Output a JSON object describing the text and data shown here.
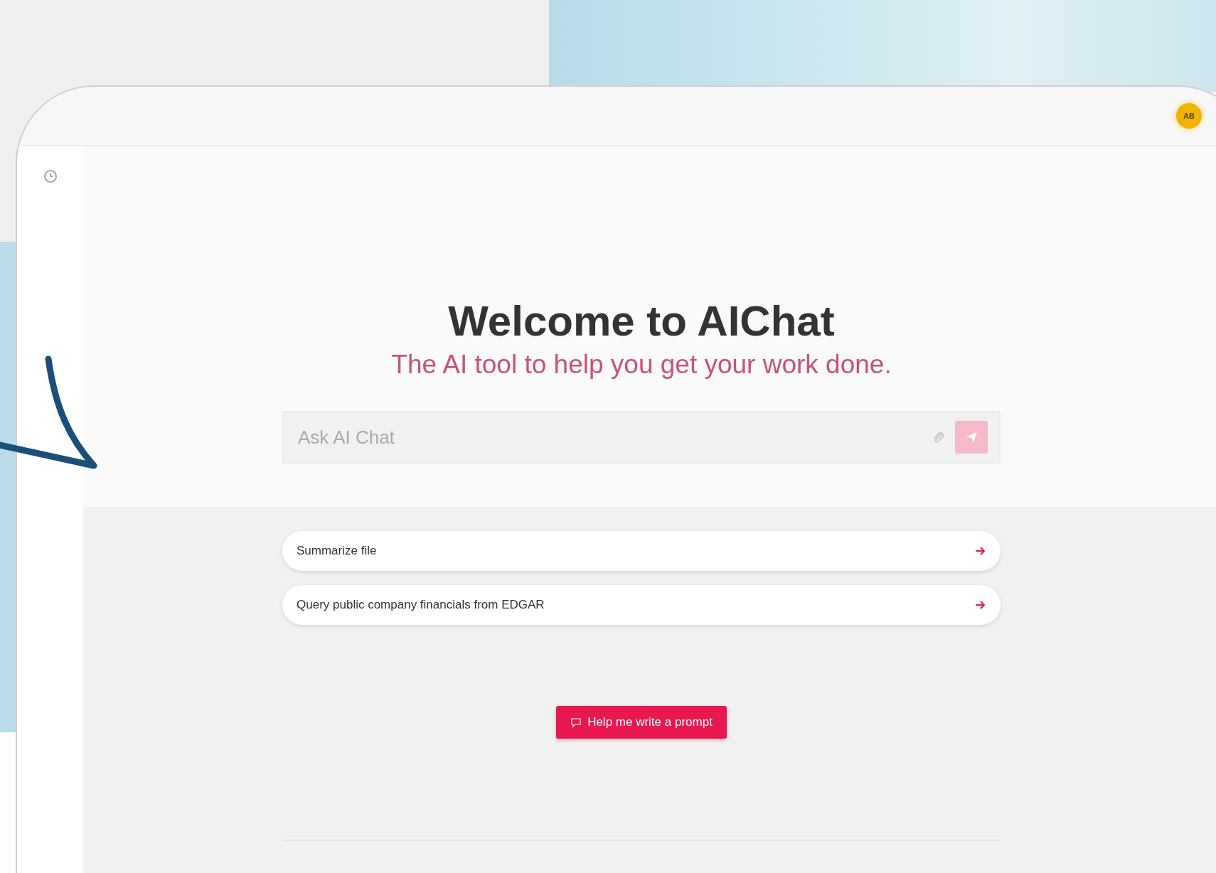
{
  "avatar": {
    "initials": "AB"
  },
  "hero": {
    "title": "Welcome to AIChat",
    "subtitle": "The AI tool to help you get your work done."
  },
  "chat_input": {
    "placeholder": "Ask AI Chat",
    "send_disabled": true
  },
  "suggestions": [
    {
      "label": "Summarize file"
    },
    {
      "label": "Query public company financials from EDGAR"
    }
  ],
  "help_button": {
    "label": "Help me write a prompt"
  }
}
